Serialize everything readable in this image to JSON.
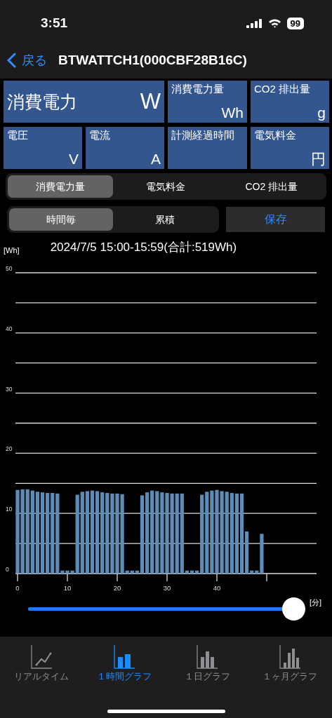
{
  "status_bar": {
    "time": "3:51",
    "battery": "99"
  },
  "nav": {
    "back": "戻る",
    "title": "BTWATTCH1(000CBF28B16C)"
  },
  "tiles": [
    {
      "kind": "large",
      "label": "消費電力",
      "unit": "W"
    },
    {
      "kind": "small",
      "label": "消費電力量",
      "unit": "Wh"
    },
    {
      "kind": "small",
      "label": "CO2 排出量",
      "unit": "g"
    },
    {
      "kind": "small",
      "label": "電圧",
      "unit": "V"
    },
    {
      "kind": "small",
      "label": "電流",
      "unit": "A"
    },
    {
      "kind": "small",
      "label": "計測経過時間"
    },
    {
      "kind": "small",
      "label": "電気料金",
      "unit": "円"
    }
  ],
  "metric_tabs": [
    {
      "label": "消費電力量",
      "selected": true
    },
    {
      "label": "電気料金",
      "selected": false
    },
    {
      "label": "CO2 排出量",
      "selected": false
    }
  ],
  "mode_tabs": [
    {
      "label": "時間毎",
      "selected": true
    },
    {
      "label": "累積",
      "selected": false
    }
  ],
  "save_button": "保存",
  "chart": {
    "chart_data": {
      "type": "bar",
      "title": "2024/7/5 15:00-15:59(合計:519Wh)",
      "ylabel": "[Wh]",
      "xlabel": "[分]",
      "x": [
        0,
        1,
        2,
        3,
        4,
        5,
        6,
        7,
        8,
        9,
        10,
        11,
        12,
        13,
        14,
        15,
        16,
        17,
        18,
        19,
        20,
        21,
        22,
        23,
        24,
        25,
        26,
        27,
        28,
        29,
        30,
        31,
        32,
        33,
        34,
        35,
        36,
        37,
        38,
        39,
        40,
        41,
        42,
        43,
        44,
        45,
        46,
        47,
        48,
        49
      ],
      "values": [
        13.9,
        14.0,
        14.0,
        13.8,
        13.6,
        13.5,
        13.4,
        13.4,
        13.3,
        0.5,
        0.5,
        0.5,
        13.1,
        13.6,
        13.7,
        13.8,
        13.7,
        13.5,
        13.4,
        13.3,
        13.3,
        13.2,
        0.5,
        0.5,
        0.5,
        13.0,
        13.5,
        13.8,
        13.7,
        13.5,
        13.4,
        13.3,
        13.3,
        13.3,
        0.5,
        0.5,
        0.5,
        13.1,
        13.6,
        13.8,
        13.9,
        13.7,
        13.6,
        13.4,
        13.3,
        13.3,
        7.0,
        0.5,
        0.5,
        6.6
      ],
      "grid": true,
      "xlim": [
        0,
        60
      ],
      "ylim": [
        0,
        50
      ],
      "xticks": [
        0,
        10,
        20,
        30,
        40
      ],
      "yticks": [
        0,
        10,
        20,
        30,
        40,
        50
      ]
    }
  },
  "range_slider": {
    "level": 1.0
  },
  "bottom_tabs": [
    {
      "kind": "line",
      "label": "リアルタイム",
      "selected": false
    },
    {
      "kind": "bars2",
      "label": "１時間グラフ",
      "selected": true
    },
    {
      "kind": "bars3",
      "label": "１日グラフ",
      "selected": false
    },
    {
      "kind": "bars4",
      "label": "１ヶ月グラフ",
      "selected": false
    }
  ]
}
